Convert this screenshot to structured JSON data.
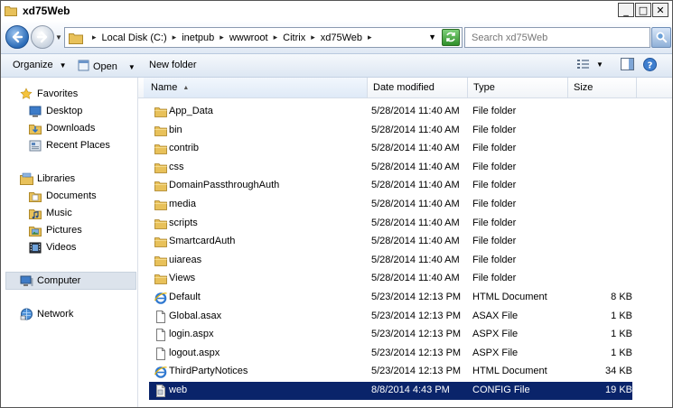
{
  "window": {
    "title": "xd75Web"
  },
  "window_buttons": {
    "minimize": "_",
    "maximize": "□",
    "close": "✕"
  },
  "address": {
    "crumbs": [
      "Local Disk (C:)",
      "inetpub",
      "wwwroot",
      "Citrix",
      "xd75Web"
    ],
    "search_placeholder": "Search xd75Web"
  },
  "toolbar": {
    "organize": "Organize",
    "open": "Open",
    "new_folder": "New folder"
  },
  "nav": {
    "favorites": {
      "label": "Favorites",
      "items": [
        "Desktop",
        "Downloads",
        "Recent Places"
      ]
    },
    "libraries": {
      "label": "Libraries",
      "items": [
        "Documents",
        "Music",
        "Pictures",
        "Videos"
      ]
    },
    "computer": "Computer",
    "network": "Network"
  },
  "columns": {
    "name": "Name",
    "date": "Date modified",
    "type": "Type",
    "size": "Size"
  },
  "files": [
    {
      "icon": "folder-icon",
      "name": "App_Data",
      "date": "5/28/2014 11:40 AM",
      "type": "File folder",
      "size": ""
    },
    {
      "icon": "folder-icon",
      "name": "bin",
      "date": "5/28/2014 11:40 AM",
      "type": "File folder",
      "size": ""
    },
    {
      "icon": "folder-icon",
      "name": "contrib",
      "date": "5/28/2014 11:40 AM",
      "type": "File folder",
      "size": ""
    },
    {
      "icon": "folder-icon",
      "name": "css",
      "date": "5/28/2014 11:40 AM",
      "type": "File folder",
      "size": ""
    },
    {
      "icon": "folder-icon",
      "name": "DomainPassthroughAuth",
      "date": "5/28/2014 11:40 AM",
      "type": "File folder",
      "size": ""
    },
    {
      "icon": "folder-icon",
      "name": "media",
      "date": "5/28/2014 11:40 AM",
      "type": "File folder",
      "size": ""
    },
    {
      "icon": "folder-icon",
      "name": "scripts",
      "date": "5/28/2014 11:40 AM",
      "type": "File folder",
      "size": ""
    },
    {
      "icon": "folder-icon",
      "name": "SmartcardAuth",
      "date": "5/28/2014 11:40 AM",
      "type": "File folder",
      "size": ""
    },
    {
      "icon": "folder-icon",
      "name": "uiareas",
      "date": "5/28/2014 11:40 AM",
      "type": "File folder",
      "size": ""
    },
    {
      "icon": "folder-icon",
      "name": "Views",
      "date": "5/28/2014 11:40 AM",
      "type": "File folder",
      "size": ""
    },
    {
      "icon": "ie-html-icon",
      "name": "Default",
      "date": "5/23/2014 12:13 PM",
      "type": "HTML Document",
      "size": "8 KB"
    },
    {
      "icon": "blank-file-icon",
      "name": "Global.asax",
      "date": "5/23/2014 12:13 PM",
      "type": "ASAX File",
      "size": "1 KB"
    },
    {
      "icon": "blank-file-icon",
      "name": "login.aspx",
      "date": "5/23/2014 12:13 PM",
      "type": "ASPX File",
      "size": "1 KB"
    },
    {
      "icon": "blank-file-icon",
      "name": "logout.aspx",
      "date": "5/23/2014 12:13 PM",
      "type": "ASPX File",
      "size": "1 KB"
    },
    {
      "icon": "ie-html-icon",
      "name": "ThirdPartyNotices",
      "date": "5/23/2014 12:13 PM",
      "type": "HTML Document",
      "size": "34 KB"
    },
    {
      "icon": "config-file-icon",
      "name": "web",
      "date": "8/8/2014 4:43 PM",
      "type": "CONFIG File",
      "size": "19 KB",
      "selected": true
    }
  ],
  "colors": {
    "selection": "#0a246a",
    "folder": "#e8c15a"
  }
}
